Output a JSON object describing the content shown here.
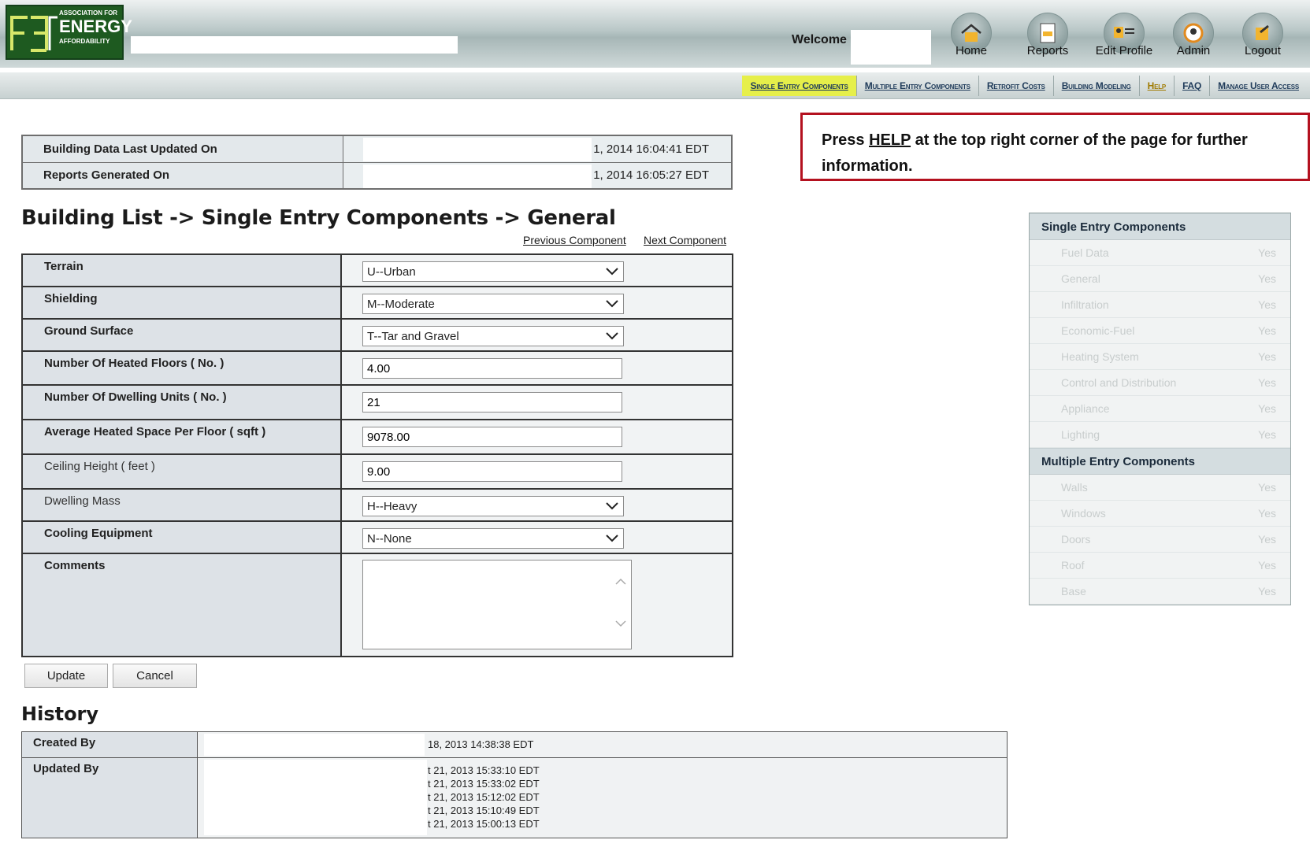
{
  "header": {
    "logo_lines": [
      "ASSOCIATION FOR",
      "ENERGY",
      "AFFORDABILITY"
    ],
    "welcome_label": "Welcome",
    "nav": [
      {
        "label": "Home",
        "icon": "home-icon"
      },
      {
        "label": "Reports",
        "icon": "reports-icon"
      },
      {
        "label": "Edit Profile",
        "icon": "edit-profile-icon"
      },
      {
        "label": "Admin",
        "icon": "admin-icon"
      },
      {
        "label": "Logout",
        "icon": "logout-icon"
      }
    ]
  },
  "subnav": {
    "items": [
      {
        "label": "Single Entry Components"
      },
      {
        "label": "Multiple Entry Components"
      },
      {
        "label": "Retrofit Costs"
      },
      {
        "label": "Building Modeling"
      },
      {
        "label": "Help"
      },
      {
        "label": "FAQ"
      },
      {
        "label": "Manage User Access"
      }
    ],
    "active_color": "#e6ef4a"
  },
  "info": {
    "rows": [
      {
        "label": "Building Data Last Updated On",
        "value": "1, 2014 16:04:41 EDT"
      },
      {
        "label": "Reports Generated On",
        "value": "1, 2014 16:05:27 EDT"
      }
    ]
  },
  "help_note": {
    "prefix": "Press",
    "link": "HELP",
    "rest": "at the top right corner of the page for further information.",
    "border_color": "#b4111f"
  },
  "page": {
    "title": "Building List -> Single Entry Components -> General",
    "prev_label": "Previous Component",
    "next_label": "Next Component"
  },
  "form": {
    "fields": [
      {
        "label": "Terrain",
        "type": "select",
        "value": "U--Urban"
      },
      {
        "label": "Shielding",
        "type": "select",
        "value": "M--Moderate"
      },
      {
        "label": "Ground Surface",
        "type": "select",
        "value": "T--Tar and Gravel"
      },
      {
        "label": "Number Of Heated Floors ( No. )",
        "type": "text",
        "value": "4.00"
      },
      {
        "label": "Number Of Dwelling Units ( No. )",
        "type": "text",
        "value": "21"
      },
      {
        "label": "Average Heated Space Per Floor ( sqft )",
        "type": "text",
        "value": "9078.00"
      },
      {
        "label": "Ceiling Height ( feet )",
        "type": "text",
        "value": "9.00"
      },
      {
        "label": "Dwelling Mass",
        "type": "select",
        "value": "H--Heavy"
      },
      {
        "label": "Cooling Equipment",
        "type": "select",
        "value": "N--None"
      },
      {
        "label": "Comments",
        "type": "textarea",
        "value": ""
      }
    ],
    "update_label": "Update",
    "cancel_label": "Cancel"
  },
  "history": {
    "title": "History",
    "created_label": "Created By",
    "created_value": "18, 2013 14:38:38 EDT",
    "updated_label": "Updated By",
    "updated_values": [
      "t 21, 2013 15:33:10 EDT",
      "t 21, 2013 15:33:02 EDT",
      "t 21, 2013 15:12:02 EDT",
      "t 21, 2013 15:10:49 EDT",
      "t 21, 2013 15:00:13 EDT"
    ]
  },
  "side_panel": {
    "single_title": "Single Entry Components",
    "single_items": [
      {
        "label": "Fuel Data",
        "status": "Yes"
      },
      {
        "label": "General",
        "status": "Yes"
      },
      {
        "label": "Infiltration",
        "status": "Yes"
      },
      {
        "label": "Economic-Fuel",
        "status": "Yes"
      },
      {
        "label": "Heating System",
        "status": "Yes"
      },
      {
        "label": "Control and Distribution",
        "status": "Yes"
      },
      {
        "label": "Appliance",
        "status": "Yes"
      },
      {
        "label": "Lighting",
        "status": "Yes"
      }
    ],
    "multiple_title": "Multiple Entry Components",
    "multiple_items": [
      {
        "label": "Walls",
        "status": "Yes"
      },
      {
        "label": "Windows",
        "status": "Yes"
      },
      {
        "label": "Doors",
        "status": "Yes"
      },
      {
        "label": "Roof",
        "status": "Yes"
      },
      {
        "label": "Base",
        "status": "Yes"
      }
    ]
  }
}
